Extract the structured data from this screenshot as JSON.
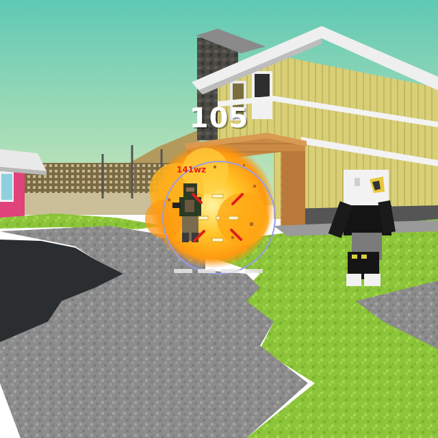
{
  "hud": {
    "damage_number": "105",
    "target_name": "141wz",
    "crosshair_color": "#e01c1c",
    "scope_ring_color": "#9a9ae8",
    "ammo_segments": 4
  },
  "scene": {
    "sky_top": "#5fc9b4",
    "sky_bottom": "#c9e6b8",
    "grass_color": "#8fc43a",
    "stone_color": "#8d8d8d",
    "water_color": "#2b2f31",
    "house_wall_color": "#d9d079",
    "explosion_color": "#ffb21e"
  }
}
